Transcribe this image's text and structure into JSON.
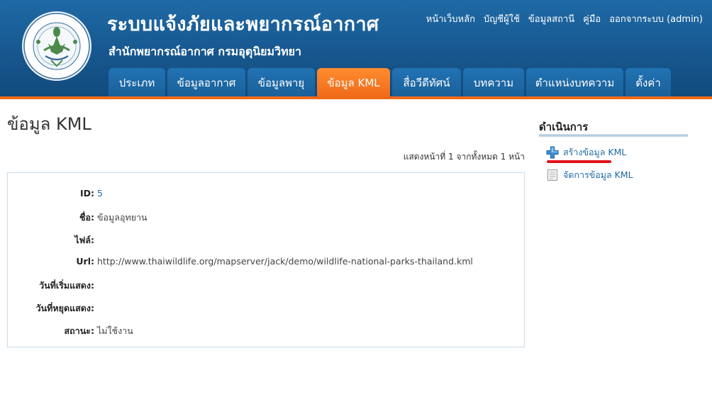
{
  "header": {
    "title": "ระบบแจ้งภัยและพยากรณ์อากาศ",
    "subtitle": "สำนักพยากรณ์อากาศ กรมอุตุนิยมวิทยา",
    "logo_text": "กรมอุตุนิยมวิทยา METEOROLOGICAL DEPARTMENT",
    "top_links": [
      "หน้าเว็บหลัก",
      "บัญชีผู้ใช้",
      "ข้อมูลสถานี",
      "คู่มือ",
      "ออกจากระบบ (admin)"
    ],
    "tabs": [
      {
        "label": "ประเภท",
        "active": false
      },
      {
        "label": "ข้อมูลอากาศ",
        "active": false
      },
      {
        "label": "ข้อมูลพายุ",
        "active": false
      },
      {
        "label": "ข้อมูล KML",
        "active": true
      },
      {
        "label": "สื่อวีดีทัศน์",
        "active": false
      },
      {
        "label": "บทความ",
        "active": false
      },
      {
        "label": "ตำแหน่งบทความ",
        "active": false
      },
      {
        "label": "ตั้งค่า",
        "active": false
      }
    ]
  },
  "main": {
    "page_title": "ข้อมูล KML",
    "pager": "แสดงหน้าที่ 1 จากทั้งหมด 1 หน้า",
    "details": [
      {
        "label": "ID:",
        "value": "5"
      },
      {
        "label": "ชื่อ:",
        "value": "ข้อมูลอุทยาน"
      },
      {
        "label": "ไฟล์:",
        "value": ""
      },
      {
        "label": "Url:",
        "value": "http://www.thaiwildlife.org/mapserver/jack/demo/wildlife-national-parks-thailand.kml"
      },
      {
        "label": "วันที่เริ่มแสดง:",
        "value": ""
      },
      {
        "label": "วันที่หยุดแสดง:",
        "value": ""
      },
      {
        "label": "สถานะ:",
        "value": "ไม่ใช้งาน"
      }
    ]
  },
  "sidebar": {
    "title": "ดำเนินการ",
    "operations": [
      {
        "label": "สร้างข้อมูล KML",
        "icon": "add-icon"
      },
      {
        "label": "จัดการข้อมูล KML",
        "icon": "document-icon"
      }
    ]
  },
  "colors": {
    "header_blue": "#17578f",
    "accent_orange": "#f06a1a",
    "link_blue": "#1f6aa6",
    "highlight_red": "#e0131b"
  }
}
